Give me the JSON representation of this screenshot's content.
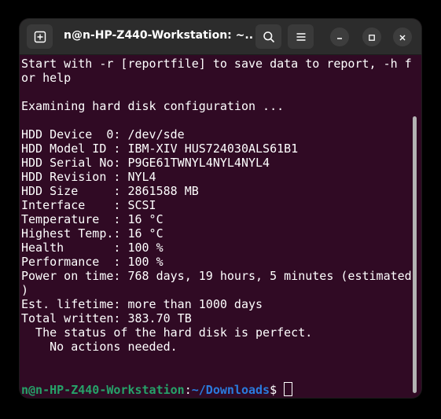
{
  "window": {
    "title": "n@n-HP-Z440-Workstation: ~..."
  },
  "icons": {
    "new_tab": "new-tab-icon",
    "search": "search-icon",
    "menu": "hamburger-menu-icon",
    "minimize": "minimize-icon",
    "maximize": "maximize-icon",
    "close": "close-icon"
  },
  "terminal": {
    "lines": [
      "Start with -r [reportfile] to save data to report, -h f",
      "or help",
      "",
      "Examining hard disk configuration ...",
      "",
      "HDD Device  0: /dev/sde",
      "HDD Model ID : IBM-XIV HUS724030ALS61B1",
      "HDD Serial No: P9GE61TWNYL4NYL4NYL4",
      "HDD Revision : NYL4",
      "HDD Size     : 2861588 MB",
      "Interface    : SCSI",
      "Temperature  : 16 °C",
      "Highest Temp.: 16 °C",
      "Health       : 100 %",
      "Performance  : 100 %",
      "Power on time: 768 days, 19 hours, 5 minutes (estimated",
      ")",
      "Est. lifetime: more than 1000 days",
      "Total written: 383.70 TB",
      "  The status of the hard disk is perfect.",
      "    No actions needed.",
      "",
      ""
    ],
    "prompt": {
      "user_host": "n@n-HP-Z440-Workstation",
      "separator": ":",
      "path": "~/Downloads",
      "symbol": "$ "
    }
  },
  "colors": {
    "terminal_bg": "#300a24",
    "prompt_user": "#26a269",
    "prompt_path": "#2a7bde",
    "titlebar_bg": "#2c2c2c"
  }
}
